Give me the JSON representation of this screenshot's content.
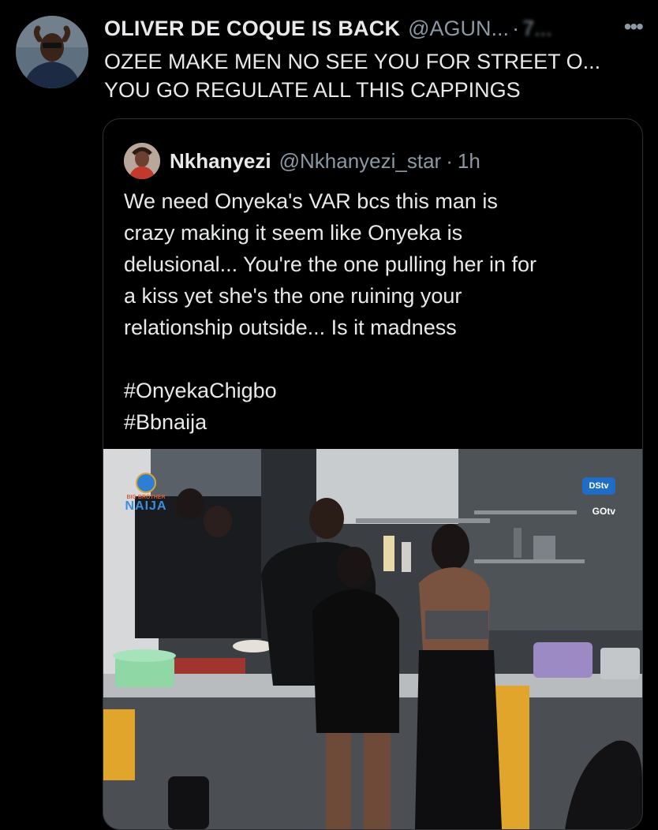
{
  "tweet": {
    "display_name": "OLIVER DE COQUE IS BACK",
    "handle": "@AGUN...",
    "separator": "·",
    "time": "7...",
    "more_icon": "more-horizontal-icon",
    "lines": [
      "OZEE MAKE MEN NO SEE YOU FOR STREET O...",
      "YOU GO REGULATE ALL THIS CAPPINGS"
    ]
  },
  "quoted_tweet": {
    "display_name": "Nkhanyezi",
    "handle": "@Nkhanyezi_star",
    "separator": "·",
    "time": "1h",
    "lines": [
      "We need Onyeka's VAR bcs this man is",
      "crazy making it seem like Onyeka is",
      "delusional... You're the one pulling her in for",
      "a kiss yet she's the one ruining your",
      "relationship outside... Is it madness"
    ],
    "hashtags": [
      "#OnyekaChigbo",
      "#Bbnaija"
    ],
    "media": {
      "logo_left_top": "BIG BROTHER",
      "logo_left_main": "NAIJA",
      "logo_dstv": "DStv",
      "logo_gotv": "GOtv"
    }
  },
  "colors": {
    "background": "#000000",
    "text_primary": "#e7e9ea",
    "text_secondary": "#8b98a5",
    "border": "#2f3336"
  }
}
